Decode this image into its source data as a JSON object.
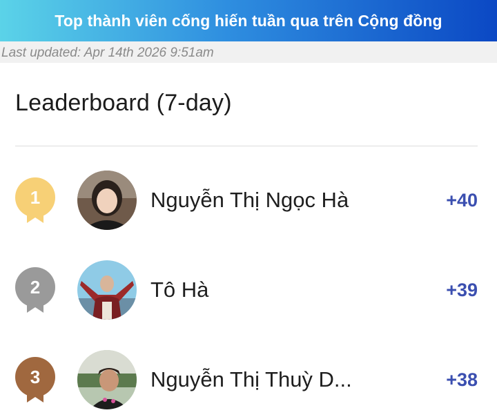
{
  "banner": {
    "title": "Top thành viên cống hiến tuần qua trên Cộng đồng"
  },
  "updated": {
    "text": "Last updated: Apr 14th 2026 9:51am"
  },
  "leaderboard": {
    "title": "Leaderboard (7-day)",
    "entries": [
      {
        "rank": "1",
        "name": "Nguyễn Thị Ngọc Hà",
        "points": "+40",
        "medal_color": "#f7d076",
        "avatar": "user-avatar-photo"
      },
      {
        "rank": "2",
        "name": "Tô Hà",
        "points": "+39",
        "medal_color": "#9a9a9a",
        "avatar": "user-avatar-photo"
      },
      {
        "rank": "3",
        "name": "Nguyễn Thị Thuỳ D...",
        "points": "+38",
        "medal_color": "#a0683f",
        "avatar": "user-avatar-photo"
      }
    ]
  },
  "colors": {
    "banner_start": "#5bd3e8",
    "banner_end": "#0b48c4",
    "points": "#3b4fb0"
  }
}
